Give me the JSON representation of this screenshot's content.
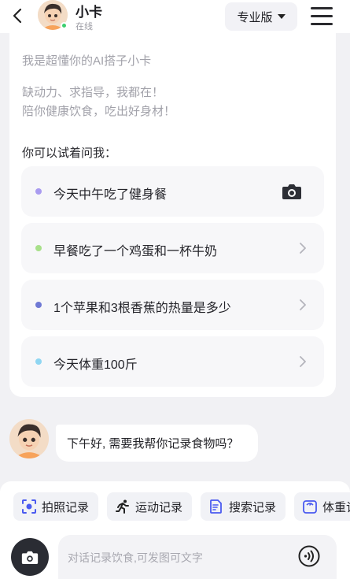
{
  "header": {
    "bot_name": "小卡",
    "status": "在线",
    "version_label": "专业版"
  },
  "welcome": {
    "intro": "我是超懂你的AI搭子小卡",
    "tagline_1": "缺动力、求指导，我都在！",
    "tagline_2": "陪你健康饮食，吃出好身材！",
    "try_label": "你可以试着问我："
  },
  "suggestions": [
    {
      "text": "今天中午吃了健身餐",
      "dot_color": "#a99bf0",
      "action_icon": "camera-icon"
    },
    {
      "text": "早餐吃了一个鸡蛋和一杯牛奶",
      "dot_color": "#a8e08a",
      "action_icon": "chevron-right-icon"
    },
    {
      "text": "1个苹果和3根香蕉的热量是多少",
      "dot_color": "#6f79d4",
      "action_icon": "chevron-right-icon"
    },
    {
      "text": "今天体重100斤",
      "dot_color": "#8fd6f2",
      "action_icon": "chevron-right-icon"
    }
  ],
  "chat": {
    "message": "下午好, 需要我帮你记录食物吗？"
  },
  "quick_actions": [
    {
      "label": "拍照记录",
      "icon": "scan-icon"
    },
    {
      "label": "运动记录",
      "icon": "running-icon"
    },
    {
      "label": "搜索记录",
      "icon": "document-search-icon"
    },
    {
      "label": "体重记",
      "icon": "scale-icon"
    }
  ],
  "composer": {
    "placeholder": "对话记录饮食,可发图可文字"
  },
  "colors": {
    "accent": "#4a5af0",
    "background": "#f1f1f4",
    "online": "#3ccf6e"
  }
}
